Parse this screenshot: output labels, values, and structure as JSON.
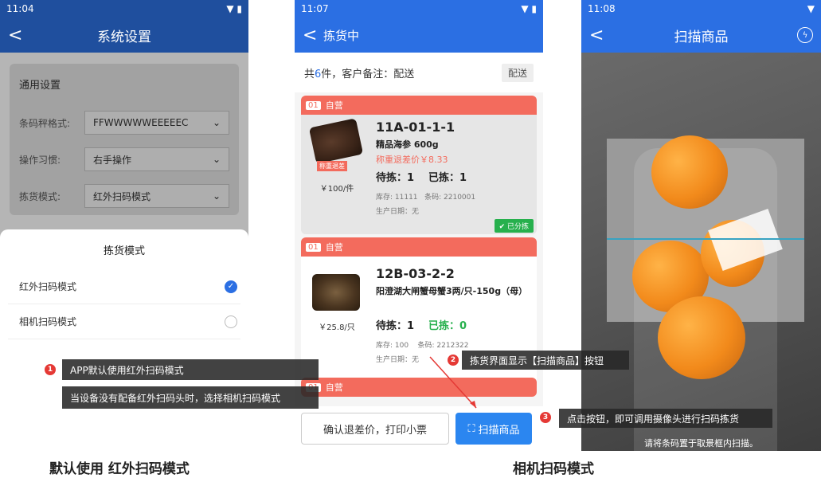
{
  "left_phone": {
    "time": "11:04",
    "title": "系统设置",
    "section_title": "通用设置",
    "settings": [
      {
        "label": "条码秤格式:",
        "value": "FFWWWWWEEEEEC"
      },
      {
        "label": "操作习惯:",
        "value": "右手操作"
      },
      {
        "label": "拣货模式:",
        "value": "红外扫码模式"
      }
    ],
    "sheet_title": "拣货模式",
    "options": [
      {
        "label": "红外扫码模式",
        "selected": true
      },
      {
        "label": "相机扫码模式",
        "selected": false
      }
    ]
  },
  "middle_phone": {
    "time": "11:07",
    "title": "拣货中",
    "summary_prefix": "共",
    "summary_count": "6",
    "summary_suffix": "件，客户备注：配送",
    "summary_tag": "配送",
    "orders": [
      {
        "num": "01",
        "type": "自营",
        "location": "11A-01-1-1",
        "name": "精品海参 600g",
        "diff": "称重退差价￥8.33",
        "img_tag": "称重退差",
        "price": "￥100/件",
        "to_pick": "待拣：1",
        "picked": "已拣：1",
        "stock": "库存: 11111",
        "barcode": "条码: 2210001",
        "prod_date": "生产日期：无",
        "status": "✔ 已分拣"
      },
      {
        "num": "01",
        "type": "自营",
        "location": "12B-03-2-2",
        "name": "阳澄湖大闸蟹母蟹3两/只-150g（母）",
        "price": "￥25.8/只",
        "to_pick": "待拣：1",
        "picked": "已拣：0",
        "stock": "库存: 100",
        "barcode": "条码: 2212322",
        "prod_date": "生产日期：无"
      },
      {
        "num": "01",
        "type": "自营"
      }
    ],
    "btn_print": "确认退差价，打印小票",
    "btn_scan": "扫描商品"
  },
  "right_phone": {
    "time": "11:08",
    "title": "扫描商品",
    "hint": "请将条码置于取景框内扫描。"
  },
  "annotations": {
    "a1_num": "1",
    "a1_line1": "APP默认使用红外扫码模式",
    "a1_line2": "当设备没有配备红外扫码头时，选择相机扫码模式",
    "a2_num": "2",
    "a2_text": "拣货界面显示【扫描商品】按钮",
    "a3_num": "3",
    "a3_text": "点击按钮，即可调用摄像头进行扫码拣货"
  },
  "captions": {
    "left": "默认使用 红外扫码模式",
    "right": "相机扫码模式"
  },
  "colors": {
    "primary_blue": "#2b6fe3",
    "accent_red": "#f36b5d",
    "green": "#27b04d"
  }
}
